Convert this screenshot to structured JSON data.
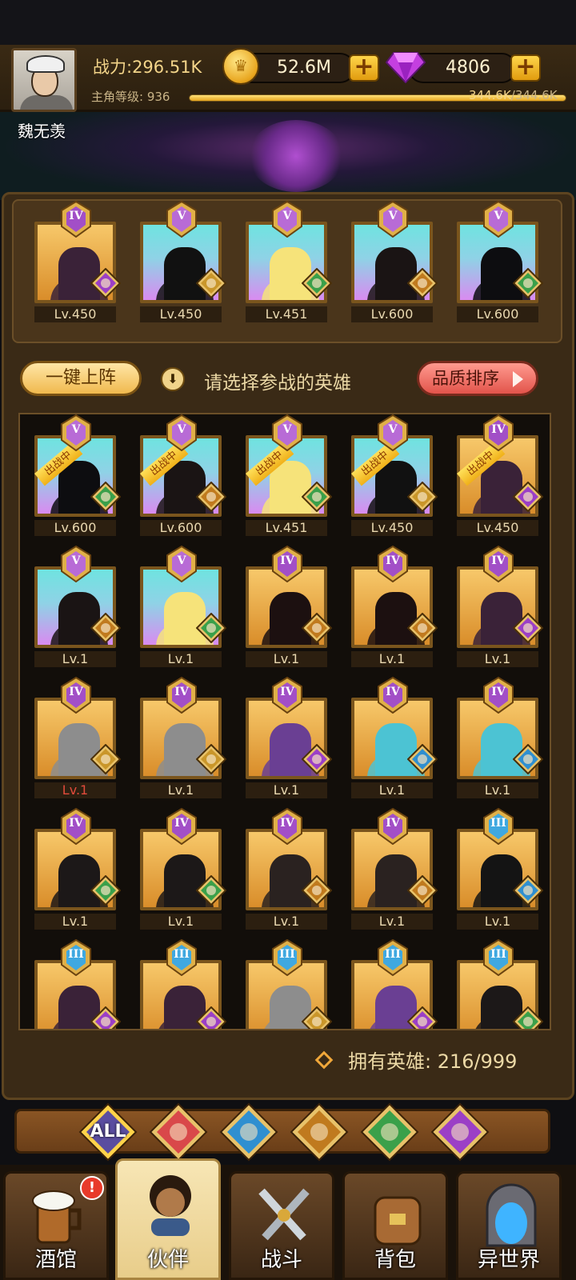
{
  "player": {
    "name": "魏无羡",
    "power_label": "战力:296.51K",
    "level_label": "主角等级: 936",
    "exp_current": "344.6K",
    "exp_max": "/344.6K",
    "exp_progress": 1.0
  },
  "currency": {
    "gold": "52.6M",
    "gold_icon": "crown-coin-icon",
    "gems": "4806",
    "gem_icon": "purple-gem-icon",
    "plus": "+"
  },
  "team": [
    {
      "rank": "IV",
      "level": "Lv.450",
      "bg": "gold",
      "faction": "demon",
      "hero_color": "#3a2238"
    },
    {
      "rank": "V",
      "level": "Lv.450",
      "bg": "cyan",
      "faction": "helm",
      "hero_color": "#111111"
    },
    {
      "rank": "V",
      "level": "Lv.451",
      "bg": "cyan",
      "faction": "elf",
      "hero_color": "#f6e37a"
    },
    {
      "rank": "V",
      "level": "Lv.600",
      "bg": "cyan",
      "faction": "beast",
      "hero_color": "#1a1414"
    },
    {
      "rank": "V",
      "level": "Lv.600",
      "bg": "cyan",
      "faction": "elf",
      "hero_color": "#0d0d10"
    }
  ],
  "actions": {
    "one_click": "一键上阵",
    "hint": "请选择参战的英雄",
    "sort": "品质排序",
    "in_battle": "出战中"
  },
  "heroes": [
    {
      "rank": "V",
      "level": "Lv.600",
      "bg": "cyan",
      "faction": "elf",
      "hero_color": "#0d0d10",
      "deployed": true
    },
    {
      "rank": "V",
      "level": "Lv.600",
      "bg": "cyan",
      "faction": "beast",
      "hero_color": "#1a1414",
      "deployed": true
    },
    {
      "rank": "V",
      "level": "Lv.451",
      "bg": "cyan",
      "faction": "elf",
      "hero_color": "#f6e37a",
      "deployed": true
    },
    {
      "rank": "V",
      "level": "Lv.450",
      "bg": "cyan",
      "faction": "helm",
      "hero_color": "#111111",
      "deployed": true
    },
    {
      "rank": "IV",
      "level": "Lv.450",
      "bg": "gold",
      "faction": "demon",
      "hero_color": "#3a2238",
      "deployed": true
    },
    {
      "rank": "V",
      "level": "Lv.1",
      "bg": "cyan",
      "faction": "beast",
      "hero_color": "#1a1414"
    },
    {
      "rank": "V",
      "level": "Lv.1",
      "bg": "cyan",
      "faction": "elf",
      "hero_color": "#f6e37a"
    },
    {
      "rank": "IV",
      "level": "Lv.1",
      "bg": "gold",
      "faction": "beast",
      "hero_color": "#1c1010"
    },
    {
      "rank": "IV",
      "level": "Lv.1",
      "bg": "gold",
      "faction": "beast",
      "hero_color": "#1c1010"
    },
    {
      "rank": "IV",
      "level": "Lv.1",
      "bg": "gold",
      "faction": "demon",
      "hero_color": "#3a2238"
    },
    {
      "rank": "IV",
      "level": "Lv.1",
      "bg": "gold",
      "faction": "helm",
      "hero_color": "#8d8d8d",
      "red": true
    },
    {
      "rank": "IV",
      "level": "Lv.1",
      "bg": "gold",
      "faction": "helm",
      "hero_color": "#8d8d8d"
    },
    {
      "rank": "IV",
      "level": "Lv.1",
      "bg": "gold",
      "faction": "demon",
      "hero_color": "#6a3f93"
    },
    {
      "rank": "IV",
      "level": "Lv.1",
      "bg": "gold",
      "faction": "fish",
      "hero_color": "#4cc3d3"
    },
    {
      "rank": "IV",
      "level": "Lv.1",
      "bg": "gold",
      "faction": "fish",
      "hero_color": "#4cc3d3"
    },
    {
      "rank": "IV",
      "level": "Lv.1",
      "bg": "gold",
      "faction": "elf",
      "hero_color": "#1c1818"
    },
    {
      "rank": "IV",
      "level": "Lv.1",
      "bg": "gold",
      "faction": "elf",
      "hero_color": "#1c1818"
    },
    {
      "rank": "IV",
      "level": "Lv.1",
      "bg": "gold",
      "faction": "beast",
      "hero_color": "#2a2220"
    },
    {
      "rank": "IV",
      "level": "Lv.1",
      "bg": "gold",
      "faction": "beast",
      "hero_color": "#2a2220"
    },
    {
      "rank": "III",
      "level": "Lv.1",
      "bg": "gold",
      "faction": "fish",
      "hero_color": "#141414"
    },
    {
      "rank": "III",
      "level": "",
      "bg": "gold",
      "faction": "demon",
      "hero_color": "#3a2238"
    },
    {
      "rank": "III",
      "level": "",
      "bg": "gold",
      "faction": "demon",
      "hero_color": "#3a2238"
    },
    {
      "rank": "III",
      "level": "",
      "bg": "gold",
      "faction": "helm",
      "hero_color": "#8d8d8d"
    },
    {
      "rank": "III",
      "level": "",
      "bg": "gold",
      "faction": "demon",
      "hero_color": "#6a3f93"
    },
    {
      "rank": "III",
      "level": "",
      "bg": "gold",
      "faction": "elf",
      "hero_color": "#1c1818"
    }
  ],
  "owned_label": "拥有英雄: 216/999",
  "filters": [
    {
      "label": "ALL",
      "icon": "all-filter-icon",
      "active": true
    },
    {
      "label": "",
      "icon": "helm-faction-icon",
      "color": "#d9484a"
    },
    {
      "label": "",
      "icon": "fish-faction-icon",
      "color": "#2f8fd0"
    },
    {
      "label": "",
      "icon": "beast-faction-icon",
      "color": "#c07a1e"
    },
    {
      "label": "",
      "icon": "elf-faction-icon",
      "color": "#3aa04a"
    },
    {
      "label": "",
      "icon": "demon-faction-icon",
      "color": "#9b3fc6"
    }
  ],
  "nav": [
    {
      "label": "酒馆",
      "icon": "beer-mug-icon",
      "badge": "!"
    },
    {
      "label": "伙伴",
      "icon": "partner-portrait-icon",
      "active": true
    },
    {
      "label": "战斗",
      "icon": "crossed-swords-icon"
    },
    {
      "label": "背包",
      "icon": "backpack-chest-icon"
    },
    {
      "label": "异世界",
      "icon": "portal-icon"
    }
  ],
  "colors": {
    "rank_V": "#b86bd6",
    "rank_IV": "#a24fc7",
    "rank_III": "#3fa8e0",
    "gold_accent": "#f0b019"
  }
}
